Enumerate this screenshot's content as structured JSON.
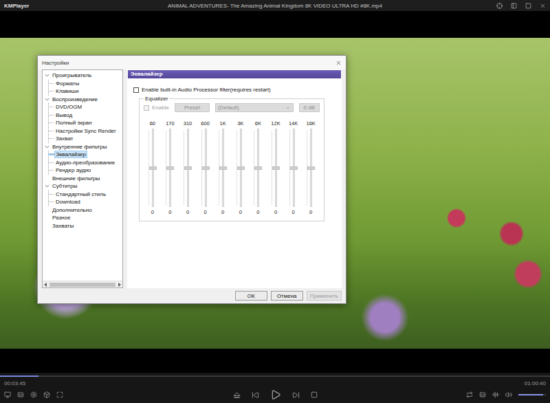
{
  "player": {
    "logo": "KMPlayer",
    "title": "ANIMAL ADVENTURES- The Amazing Animal Kingdom 8K VIDEO ULTRA HD #8K.mp4",
    "elapsed": "00:03:45",
    "duration": "01:00:40",
    "progress": 0.07,
    "volume": 0.9
  },
  "dialog": {
    "title": "Настройки",
    "tree": [
      {
        "label": "Проигрыватель",
        "selected": false,
        "expanded": true,
        "children": [
          {
            "label": "Форматы",
            "selected": false
          },
          {
            "label": "Клавиши",
            "selected": false
          }
        ]
      },
      {
        "label": "Воспроизведение",
        "selected": false,
        "expanded": true,
        "children": [
          {
            "label": "DVD/OGM",
            "selected": false
          },
          {
            "label": "Вывод",
            "selected": false
          },
          {
            "label": "Полный экран",
            "selected": false
          },
          {
            "label": "Настройки Sync Render",
            "selected": false
          },
          {
            "label": "Захват",
            "selected": false
          }
        ]
      },
      {
        "label": "Внутренние фильтры",
        "selected": false,
        "expanded": true,
        "children": [
          {
            "label": "Эквалайзер",
            "selected": true
          },
          {
            "label": "Аудио-преобразование",
            "selected": false
          },
          {
            "label": "Рендер аудио",
            "selected": false
          }
        ]
      },
      {
        "label": "Внешние фильтры",
        "selected": false
      },
      {
        "label": "Субтитры",
        "selected": false,
        "expanded": true,
        "children": [
          {
            "label": "Стандартный стиль",
            "selected": false
          },
          {
            "label": "Download",
            "selected": false
          }
        ]
      },
      {
        "label": "Дополнительно",
        "selected": false
      },
      {
        "label": "Разное",
        "selected": false
      },
      {
        "label": "Захваты",
        "selected": false
      }
    ],
    "page": {
      "title": "Эквалайзер",
      "processor": {
        "label": "Enable built-in Audio Processor filter(requires restart)",
        "checked": false,
        "disabled": false
      },
      "group": "Equalizer",
      "enable": {
        "label": "Enable",
        "checked": false,
        "disabled": true
      },
      "preset": {
        "label": "Preset",
        "disabled": true
      },
      "dropdown": {
        "value": "(Default)",
        "disabled": true
      },
      "reset": {
        "label": "0 dB",
        "disabled": true
      },
      "bands": [
        {
          "freq": "60",
          "value": "0",
          "level": 0.5,
          "disabled": true
        },
        {
          "freq": "170",
          "value": "0",
          "level": 0.5,
          "disabled": true
        },
        {
          "freq": "310",
          "value": "0",
          "level": 0.5,
          "disabled": true
        },
        {
          "freq": "600",
          "value": "0",
          "level": 0.5,
          "disabled": true
        },
        {
          "freq": "1K",
          "value": "0",
          "level": 0.5,
          "disabled": true
        },
        {
          "freq": "3K",
          "value": "0",
          "level": 0.5,
          "disabled": true
        },
        {
          "freq": "6K",
          "value": "0",
          "level": 0.5,
          "disabled": true
        },
        {
          "freq": "12K",
          "value": "0",
          "level": 0.5,
          "disabled": true
        },
        {
          "freq": "14K",
          "value": "0",
          "level": 0.5,
          "disabled": true
        },
        {
          "freq": "16K",
          "value": "0",
          "level": 0.5,
          "disabled": true
        }
      ]
    },
    "buttons": [
      {
        "label": "ОК",
        "disabled": false
      },
      {
        "label": "Отмена",
        "disabled": false
      },
      {
        "label": "Применить",
        "disabled": true
      }
    ]
  }
}
